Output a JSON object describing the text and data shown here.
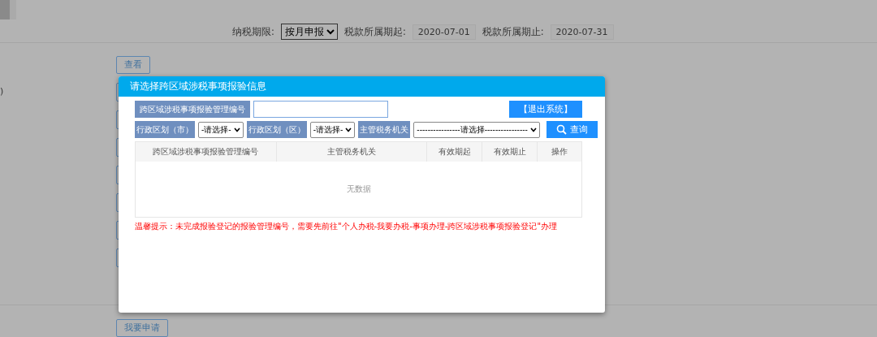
{
  "page": {
    "filter": {
      "period_label": "纳税期限:",
      "period_value": "按月申报",
      "start_label": "税款所属期起:",
      "start_value": "2020-07-01",
      "end_label": "税款所属期止:",
      "end_value": "2020-07-31"
    },
    "view_button": "查看",
    "side_text": ")",
    "apply_button": "我要申请"
  },
  "dialog": {
    "title": "请选择跨区域涉税事项报验信息",
    "number_label": "跨区域涉税事项报验管理编号",
    "exit_button": "【退出系统】",
    "city_label": "行政区划（市）",
    "city_value": "-请选择-",
    "district_label": "行政区划（区）",
    "district_value": "-请选择-",
    "authority_label": "主管税务机关",
    "authority_value": "----------------请选择----------------",
    "search_button": "查询",
    "table": {
      "columns": [
        "跨区域涉税事项报验管理编号",
        "主管税务机关",
        "有效期起",
        "有效期止",
        "操作"
      ],
      "empty_text": "无数据"
    },
    "notice": "温馨提示：未完成报验登记的报验管理编号，需要先前往\"个人办税-我要办税-事项办理-跨区域涉税事项报验登记\"办理"
  }
}
